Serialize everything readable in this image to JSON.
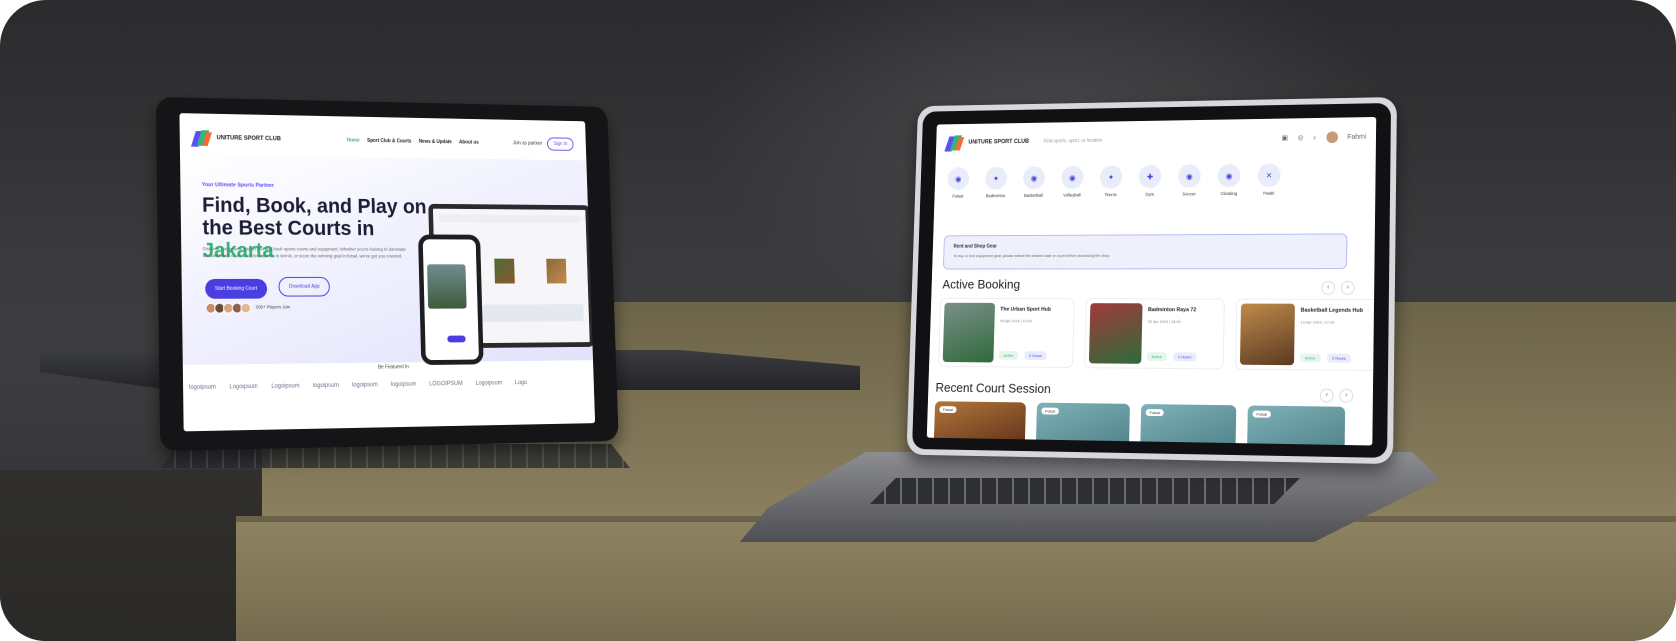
{
  "laptop_left": {
    "brand": "UNITURE SPORT CLUB",
    "nav": [
      "Home",
      "Sport Club & Courts",
      "News & Update",
      "About us"
    ],
    "join_label": "Join as partner",
    "signin_label": "Sign In",
    "eyebrow": "Your Ultimate Sports Partner",
    "title_main": "Find, Book, and Play on the Best Courts in ",
    "title_highlight": "Jakarta",
    "description": "Discover the easiest way to find and book sports courts and equipment. Whether you're looking to dominate the basketball court, and clear serves in tennis, or score the winning goal in futsal, we've got you covered.",
    "primary_button": "Start Booking Court",
    "secondary_button": "Download App",
    "users_label": "500+ Players Join",
    "trusted_label": "Be Featured In",
    "partner_logos": [
      "logoipsum",
      "Logoipsum",
      "Logoipsum",
      "logoipsum",
      "logoipsum",
      "logoipsum",
      "LOGOIPSUM",
      "Logoipsum",
      "Logo"
    ]
  },
  "laptop_right": {
    "brand": "UNITURE SPORT CLUB",
    "search_placeholder": "Find sports, sport, or location",
    "user_name": "Fahmi",
    "categories": [
      {
        "label": "Futsal",
        "icon": "futsal-icon"
      },
      {
        "label": "Badminton",
        "icon": "badminton-icon"
      },
      {
        "label": "Basketball",
        "icon": "basketball-icon"
      },
      {
        "label": "Volleyball",
        "icon": "volleyball-icon"
      },
      {
        "label": "Tennis",
        "icon": "tennis-icon"
      },
      {
        "label": "Gym",
        "icon": "gym-icon"
      },
      {
        "label": "Soccer",
        "icon": "soccer-icon"
      },
      {
        "label": "Climbing",
        "icon": "climbing-icon"
      },
      {
        "label": "Padel",
        "icon": "padel-icon"
      }
    ],
    "alert_title": "Rent and Shop Gear",
    "alert_text": "To buy or rent equipment gear, please select the desired date or court before accessing the shop.",
    "active_booking_title": "Active Booking",
    "bookings": [
      {
        "name": "The Urban Sport Hub",
        "date": "05 Apr 2024 | 10:00",
        "status": "Active",
        "duration": "2 Hours"
      },
      {
        "name": "Badminton Raya 72",
        "date": "05 Apr 2024 | 16:00",
        "status": "Active",
        "duration": "2 Hours"
      },
      {
        "name": "Basketball Legends Hub",
        "date": "13 Apr 2024 | 17:00",
        "status": "Active",
        "duration": "2 Hours"
      }
    ],
    "recent_title": "Recent Court Session",
    "sessions": [
      "Futsal",
      "Futsal",
      "Futsal",
      "Futsal"
    ]
  },
  "colors": {
    "primary": "#4a3ee0",
    "accent_green": "#2fb876"
  }
}
